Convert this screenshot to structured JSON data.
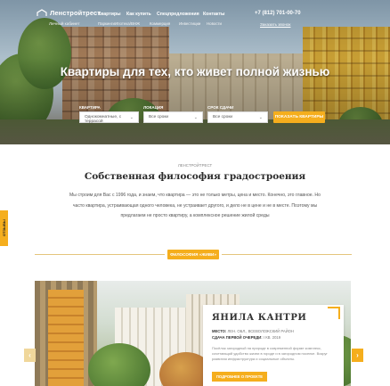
{
  "header": {
    "logo_text": "Ленстройтрест",
    "logo_sub": "Личный кабинет",
    "nav_top": [
      "Квартиры",
      "Как купить",
      "Спецпредложения",
      "Контакты"
    ],
    "nav_bottom": [
      "Паркинги",
      "Коммерция",
      "Инвестиции",
      "Новости"
    ],
    "nav_bottom_mid": "Ипотека/ВНЖ",
    "phone": "+7 (812) 701-00-70",
    "callback": "Заказать звонок"
  },
  "hero": {
    "title": "Квартиры для тех, кто живет полной жизнью",
    "filters": [
      {
        "label": "КВАРТИРА",
        "value": "Однокомнатные, с террасой"
      },
      {
        "label": "ЛОКАЦИЯ",
        "value": "Все сроки"
      },
      {
        "label": "СРОК СДАЧИ",
        "value": "Все сроки"
      }
    ],
    "show_button": "ПОКАЗАТЬ КВАРТИРЫ"
  },
  "intro": {
    "eyebrow": "ЛЕНСТРОЙТРЕСТ",
    "title": "Собственная философия градостроения",
    "text": "Мы строим для Вас с 1996 года, и знаем, что квартира — это не только метры, цена и место. Конечно, это главное. Но часто квартира, устраивающая одного человека, не устраивает другого, и дело не в цене и не в месте. Поэтому мы предлагаем не просто квартиру, а комплексное решение жилой среды",
    "side_tab": "ОТЗЫВЫ",
    "philosophy_button": "ФИЛОСОФИЯ «ЖИВИ»"
  },
  "project": {
    "title": "ЯНИЛА КАНТРИ",
    "line1_label": "МЕСТО:",
    "line1_value": "ЛЕН. ОБЛ., ВСЕВОЛОЖСКИЙ РАЙОН",
    "line2_label": "СДАЧА ПЕРВОЙ ОЧЕРЕДИ:",
    "line2_value": "I КВ. 2019",
    "description": "Посёлок загородный на природе в современной форме комплекс, сочетающий удобство жизни в городе и в загородном поселке. Вокруг развитая инфраструктура и социальные объекты.",
    "button": "ПОДРОБНЕЕ О ПРОЕКТЕ",
    "arrow_left": "‹",
    "arrow_right": "›"
  },
  "colors": {
    "accent": "#f5ae1d",
    "text_dark": "#2b2b2b",
    "text_muted": "#555555"
  }
}
